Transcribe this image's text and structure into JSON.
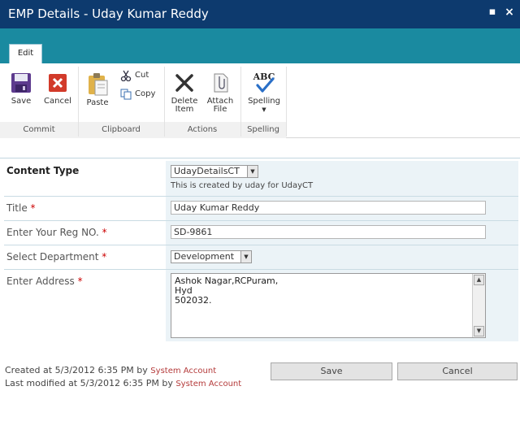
{
  "dialog": {
    "title": "EMP Details - Uday Kumar Reddy",
    "maximize_glyph": "▪",
    "close_glyph": "×"
  },
  "ribbon": {
    "tab_label": "Edit",
    "groups": {
      "commit": "Commit",
      "clipboard": "Clipboard",
      "actions": "Actions",
      "spelling": "Spelling"
    },
    "buttons": {
      "save": "Save",
      "cancel": "Cancel",
      "paste": "Paste",
      "cut": "Cut",
      "copy": "Copy",
      "delete_line1": "Delete",
      "delete_line2": "Item",
      "attach_line1": "Attach",
      "attach_line2": "File",
      "spelling": "Spelling",
      "spelling_abc": "ABC"
    }
  },
  "form": {
    "content_type": {
      "label": "Content Type",
      "value": "UdayDetailsCT",
      "hint": "This is created by uday for UdayCT"
    },
    "title": {
      "label": "Title",
      "value": "Uday Kumar Reddy"
    },
    "reg_no": {
      "label": "Enter Your Reg NO.",
      "value": "SD-9861"
    },
    "department": {
      "label": "Select Department",
      "value": "Development"
    },
    "address": {
      "label": "Enter Address",
      "lines": [
        "Ashok Nagar,RCPuram,",
        "Hyd",
        "502032."
      ]
    },
    "required_marker": "*"
  },
  "footer": {
    "created_prefix": "Created at 5/3/2012 6:35 PM by ",
    "created_by": "System Account",
    "modified_prefix": "Last modified at 5/3/2012 6:35 PM by ",
    "modified_by": "System Account",
    "save": "Save",
    "cancel": "Cancel"
  },
  "colors": {
    "titlebar": "#0d3a6e",
    "tabstrip": "#1a8aa0",
    "field_bg": "#ebf3f7",
    "required": "#cc0000",
    "link": "#b43a3a"
  }
}
